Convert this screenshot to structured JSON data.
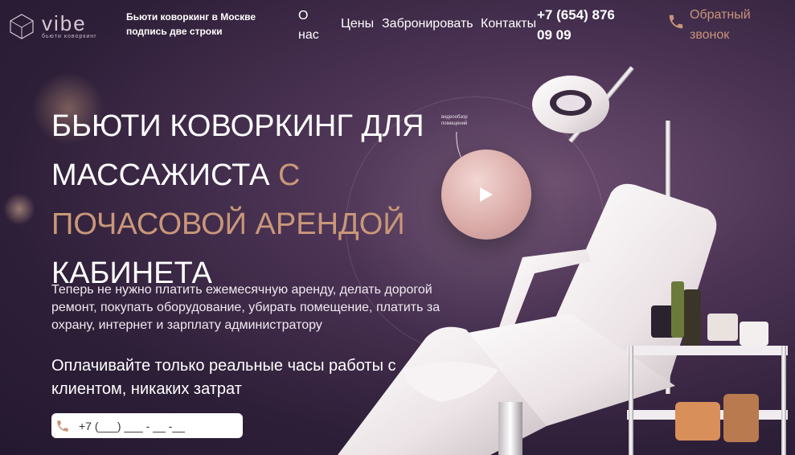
{
  "header": {
    "logo_word": "vibe",
    "logo_sub": "бьюти коворкинг",
    "tagline": "Бьюти коворкинг в Москве подпись две строки",
    "nav": {
      "about": "О нас",
      "prices": "Цены",
      "book": "Забронировать",
      "contacts": "Контакты"
    },
    "phone": "+7 (654) 876 09 09",
    "callback": "Обратный звонок"
  },
  "hero": {
    "headline_1": "БЬЮТИ КОВОРКИНГ ДЛЯ МАССАЖИСТА ",
    "headline_hl": "С ПОЧАСОВОЙ АРЕНДОЙ",
    "headline_2": " КАБИНЕТА",
    "lead": "Теперь не нужно платить ежемесячную аренду, делать дорогой ремонт, покупать оборудование, убирать помещение, платить за охрану, интернет и зарплату администратору",
    "subhead": "Оплачивайте только реальные часы работы с клиентом, никаких затрат",
    "phone_placeholder": "+7 (___) ___ - __ -__",
    "video_caption": "видеообзор помещений"
  },
  "colors": {
    "accent": "#c99779",
    "callback": "#c9957a",
    "bg_dark": "#2e1f38"
  },
  "icons": [
    "logo-cube-icon",
    "phone-icon",
    "play-icon"
  ]
}
